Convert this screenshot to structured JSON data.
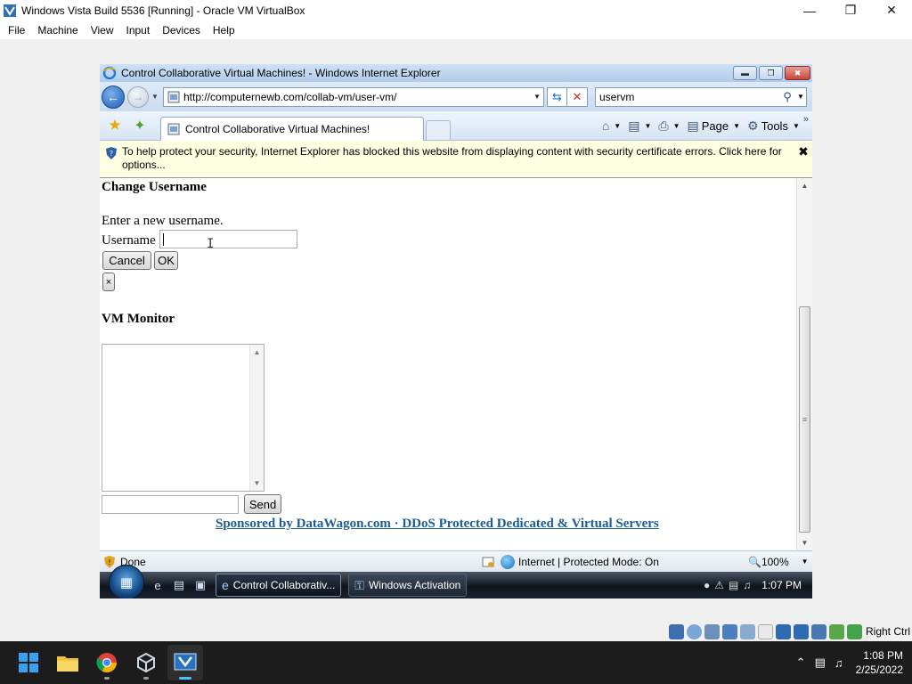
{
  "host": {
    "title": "Windows Vista Build 5536 [Running] - Oracle VM VirtualBox",
    "menu": [
      "File",
      "Machine",
      "View",
      "Input",
      "Devices",
      "Help"
    ],
    "status_host_key": "Right Ctrl"
  },
  "ie": {
    "title": "Control Collaborative Virtual Machines! - Windows Internet Explorer",
    "address": "http://computernewb.com/collab-vm/user-vm/",
    "search_text": "uservm",
    "tab_label": "Control Collaborative Virtual Machines!",
    "commands": {
      "page": "Page",
      "tools": "Tools"
    },
    "infobar_message": "To help protect your security, Internet Explorer has blocked this website from displaying content with security certificate errors. Click here for options...",
    "status": {
      "text": "Done",
      "zone": "Internet | Protected Mode: On",
      "zoom": "100%"
    }
  },
  "page": {
    "change_username_heading": "Change Username",
    "enter_prompt": "Enter a new username.",
    "username_label": "Username",
    "username_value": "",
    "cancel_label": "Cancel",
    "ok_label": "OK",
    "close_label": "×",
    "vm_monitor_heading": "VM Monitor",
    "chat_value": "",
    "send_label": "Send",
    "sponsor_text": "Sponsored by DataWagon.com · DDoS Protected Dedicated & Virtual Servers"
  },
  "guest_taskbar": {
    "buttons": [
      {
        "label": "Control Collaborativ...",
        "icon": "ie-icon",
        "active": true
      },
      {
        "label": "Windows Activation",
        "icon": "key-icon",
        "active": false
      }
    ],
    "clock": "1:07 PM"
  },
  "host_taskbar": {
    "apps": [
      "start",
      "file-explorer",
      "chrome",
      "virtualbox-app",
      "virtualbox-vm"
    ],
    "time": "1:08 PM",
    "date": "2/25/2022"
  }
}
